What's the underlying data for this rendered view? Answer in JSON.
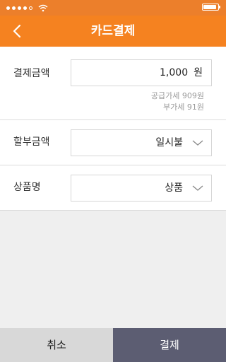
{
  "header": {
    "title": "카드결제",
    "back_icon": "chevron-left-icon"
  },
  "colors": {
    "accent": "#f58220",
    "status_bar": "#ec7f2b",
    "pay_button": "#5c5d72",
    "cancel_button": "#d8d8d8"
  },
  "form": {
    "amount": {
      "label": "결제금액",
      "value": "1,000",
      "unit": "원",
      "supply_price": "공급가세 909원",
      "vat": "부가세 91원"
    },
    "installment": {
      "label": "할부금액",
      "value": "일시불"
    },
    "product": {
      "label": "상품명",
      "value": "상품"
    }
  },
  "footer": {
    "cancel_label": "취소",
    "pay_label": "결제"
  }
}
